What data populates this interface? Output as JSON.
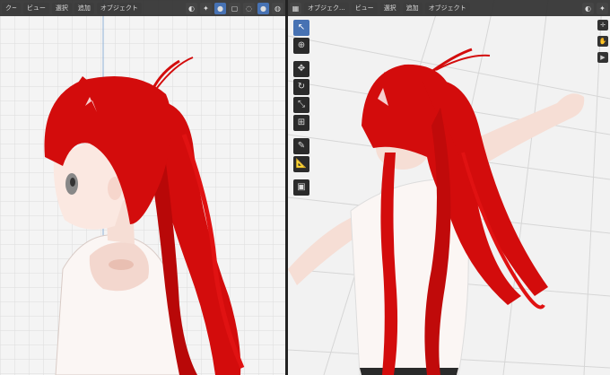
{
  "left_viewport": {
    "menu": [
      "ビュー",
      "選択",
      "追加",
      "オブジェクト"
    ],
    "header_icons": [
      "view-icon",
      "shading-icon"
    ]
  },
  "right_viewport": {
    "mode_label": "オブジェク...",
    "menu": [
      "ビュー",
      "選択",
      "追加",
      "オブジェクト"
    ],
    "tools": [
      "select-box-icon",
      "cursor-icon",
      "move-icon",
      "rotate-icon",
      "scale-icon",
      "transform-icon",
      "annotate-icon",
      "measure-icon",
      "add-cube-icon"
    ]
  },
  "colors": {
    "hair": "#d30c0c",
    "skin": "#f7e3db",
    "shirt": "#fbf6f4",
    "ui_dark": "#303030",
    "accent": "#4772b3"
  }
}
